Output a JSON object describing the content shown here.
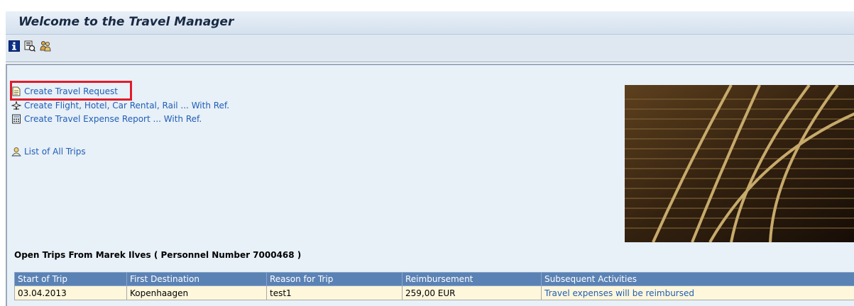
{
  "header": {
    "title": "Welcome to the Travel Manager"
  },
  "toolbar": {
    "icons": [
      "info-icon",
      "overview-icon",
      "users-icon"
    ]
  },
  "links": [
    {
      "label": "Create Travel Request",
      "icon": "document-icon"
    },
    {
      "label": "Create Flight, Hotel, Car Rental, Rail ... With Ref.",
      "icon": "airplane-icon"
    },
    {
      "label": "Create Travel Expense Report ... With Ref.",
      "icon": "calculator-icon"
    },
    {
      "label": "List of All Trips",
      "icon": "person-list-icon"
    }
  ],
  "highlight_color": "#e01c2b",
  "trips": {
    "heading": "Open Trips From Marek Ilves ( Personnel Number 7000468 )",
    "columns": [
      "Start of Trip",
      "First Destination",
      "Reason for Trip",
      "Reimbursement",
      "Subsequent Activities"
    ],
    "rows": [
      [
        "03.04.2013",
        "Kopenhaagen",
        "test1",
        "259,00 EUR",
        "Travel expenses will be reimbursed"
      ]
    ]
  },
  "colors": {
    "table_header": "#5b82b5",
    "row_background": "#fff7dc",
    "link": "#1f5eb5"
  }
}
